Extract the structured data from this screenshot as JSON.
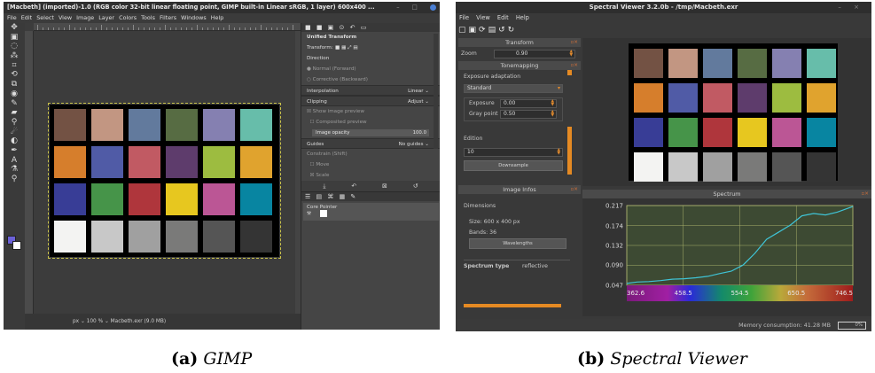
{
  "gimp": {
    "title": "[Macbeth] (imported)-1.0 (RGB color 32-bit linear floating point, GIMP built-in Linear sRGB, 1 layer) 600x400 ...",
    "menu": [
      "File",
      "Edit",
      "Select",
      "View",
      "Image",
      "Layer",
      "Colors",
      "Tools",
      "Filters",
      "Windows",
      "Help"
    ],
    "status": {
      "unit": "px",
      "zoom": "100 %",
      "file": "Macbeth.exr (9.0 MB)"
    },
    "tool_options": {
      "header": "Unified Transform",
      "transform_label": "Transform:",
      "direction_label": "Direction",
      "direction_normal": "Normal (Forward)",
      "direction_corrective": "Corrective (Backward)",
      "interpolation_label": "Interpolation",
      "interpolation_value": "Linear",
      "clipping_label": "Clipping",
      "clipping_value": "Adjust",
      "show_preview": "Show image preview",
      "composited_preview": "Composited preview",
      "image_opacity_label": "Image opacity",
      "image_opacity_value": "100.0",
      "guides_label": "Guides",
      "guides_value": "No guides",
      "constrain_label": "Constrain (Shift)",
      "move_label": "Move",
      "scale_label": "Scale"
    },
    "pointer": {
      "header": "Core Pointer"
    }
  },
  "spectral": {
    "title": "Spectral Viewer 3.2.0b - /tmp/Macbeth.exr",
    "menu": [
      "File",
      "View",
      "Edit",
      "Help"
    ],
    "transform": {
      "title": "Transform",
      "zoom_label": "Zoom",
      "zoom_value": "0.90"
    },
    "tonemapping": {
      "title": "Tonemapping",
      "exposure_adaptation_label": "Exposure adaptation",
      "mode": "Standard",
      "exposure_label": "Exposure",
      "exposure_value": "0.00",
      "gray_point_label": "Gray point",
      "gray_point_value": "0.50",
      "edition_label": "Edition",
      "edition_value": "10",
      "downsample_label": "Downsample"
    },
    "image_infos": {
      "title": "Image Infos",
      "dimensions_label": "Dimensions",
      "size_text": "Size:  600 x 400 px",
      "bands_text": "Bands: 36",
      "wavelengths_label": "Wavelengths",
      "spectrum_type_label": "Spectrum type",
      "spectrum_type_value": "reflective"
    },
    "spectrum_title": "Spectrum",
    "status": {
      "memory": "Memory consumption: 41.28 MB",
      "progress": "0%"
    }
  },
  "macbeth_colors": [
    "#735244",
    "#c29682",
    "#627a9d",
    "#576c43",
    "#8580b1",
    "#67bdaa",
    "#d67e2c",
    "#505ba6",
    "#c15a63",
    "#5e3c6c",
    "#9dbc40",
    "#e0a32e",
    "#383d96",
    "#469449",
    "#af363c",
    "#e7c71f",
    "#bb5695",
    "#0885a1",
    "#f3f3f2",
    "#c8c8c8",
    "#a0a0a0",
    "#7a7a79",
    "#555555",
    "#343434"
  ],
  "chart_data": {
    "type": "line",
    "xlim": [
      362.6,
      746.5
    ],
    "ylim": [
      0.047,
      0.217
    ],
    "x_ticks": [
      "362.6",
      "458.5",
      "554.5",
      "650.5",
      "746.5"
    ],
    "y_ticks": [
      "0.217",
      "0.174",
      "0.132",
      "0.090",
      "0.047"
    ],
    "series": [
      {
        "x": [
          362.6,
          380,
          400,
          420,
          440,
          460,
          480,
          500,
          520,
          540,
          560,
          580,
          600,
          620,
          640,
          660,
          680,
          700,
          720,
          746.5
        ],
        "values": [
          0.051,
          0.054,
          0.055,
          0.057,
          0.06,
          0.061,
          0.063,
          0.066,
          0.072,
          0.077,
          0.09,
          0.115,
          0.145,
          0.16,
          0.175,
          0.195,
          0.2,
          0.197,
          0.203,
          0.215
        ]
      }
    ]
  },
  "captions": {
    "a_tag": "(a)",
    "a_name": "GIMP",
    "b_tag": "(b)",
    "b_name": "Spectral Viewer"
  }
}
